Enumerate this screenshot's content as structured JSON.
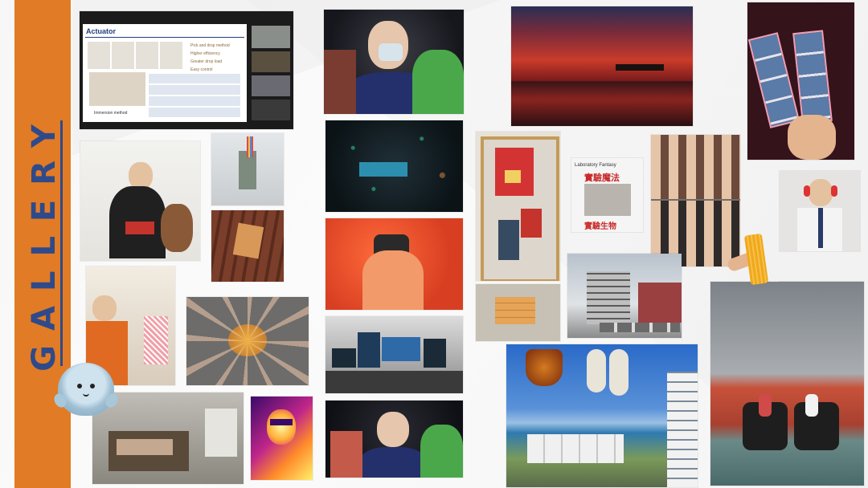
{
  "slide": {
    "gallery_title": "GALLERY",
    "colors": {
      "accent_orange": "#e17b25",
      "title_blue": "#2f4a8a"
    }
  },
  "zoom_slide": {
    "title": "Actuator",
    "items": [
      "Pick and drop method",
      "Higher efficiency",
      "Greater drop load",
      "Easy control"
    ],
    "caption": "Immersion method"
  },
  "poster": {
    "top_text": "Laboratory Fantasy",
    "big_text": "實驗魔法",
    "bottom_text": "實驗生物"
  },
  "photos": [
    {
      "name": "zoom-meeting-photo"
    },
    {
      "name": "night-selfie-group-photo"
    },
    {
      "name": "sunset-sea-photo"
    },
    {
      "name": "photobooth-strips-photo"
    },
    {
      "name": "robot-desk-photo"
    },
    {
      "name": "gift-presentation-photo"
    },
    {
      "name": "disco-room-photo"
    },
    {
      "name": "mirror-selfie-red-shirt-photo"
    },
    {
      "name": "lab-poster-photo"
    },
    {
      "name": "group-selfie-photo"
    },
    {
      "name": "headphone-selfie-photo"
    },
    {
      "name": "wooden-bench-photo"
    },
    {
      "name": "camera-red-light-photo"
    },
    {
      "name": "high-five-baby-photo"
    },
    {
      "name": "hands-circle-food-photo"
    },
    {
      "name": "workstation-monitors-photo"
    },
    {
      "name": "cake-box-photo"
    },
    {
      "name": "building-street-photo"
    },
    {
      "name": "sunglasses-gym-photo"
    },
    {
      "name": "beach-shoes-drink-photo"
    },
    {
      "name": "atv-cliff-photo"
    },
    {
      "name": "sleeping-room-photo"
    },
    {
      "name": "thermal-camera-photo"
    },
    {
      "name": "night-selfie-trio-photo"
    }
  ]
}
